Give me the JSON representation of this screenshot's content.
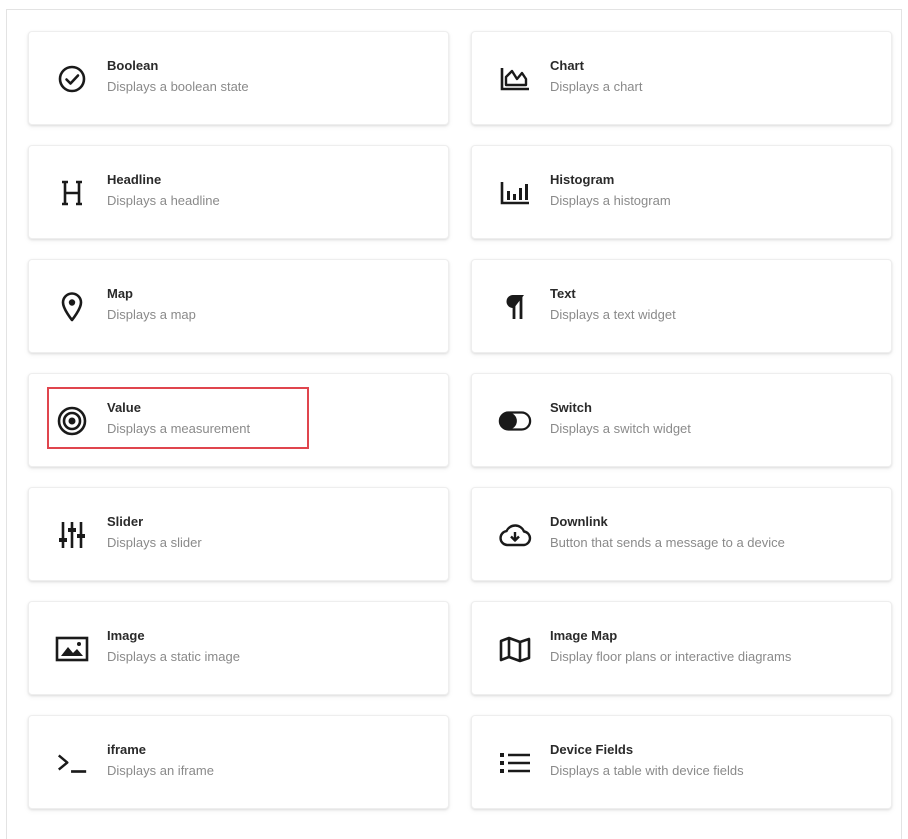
{
  "widgets": [
    {
      "title": "Boolean",
      "description": "Displays a boolean state",
      "icon": "check-circle-icon"
    },
    {
      "title": "Chart",
      "description": "Displays a chart",
      "icon": "area-chart-icon"
    },
    {
      "title": "Headline",
      "description": "Displays a headline",
      "icon": "headline-h-icon"
    },
    {
      "title": "Histogram",
      "description": "Displays a histogram",
      "icon": "bar-chart-icon"
    },
    {
      "title": "Map",
      "description": "Displays a map",
      "icon": "map-pin-icon"
    },
    {
      "title": "Text",
      "description": "Displays a text widget",
      "icon": "pilcrow-icon"
    },
    {
      "title": "Value",
      "description": "Displays a measurement",
      "icon": "target-icon"
    },
    {
      "title": "Switch",
      "description": "Displays a switch widget",
      "icon": "toggle-icon"
    },
    {
      "title": "Slider",
      "description": "Displays a slider",
      "icon": "sliders-icon"
    },
    {
      "title": "Downlink",
      "description": "Button that sends a message to a device",
      "icon": "cloud-download-icon"
    },
    {
      "title": "Image",
      "description": "Displays a static image",
      "icon": "image-icon"
    },
    {
      "title": "Image Map",
      "description": "Display floor plans or interactive diagrams",
      "icon": "folded-map-icon"
    },
    {
      "title": "iframe",
      "description": "Displays an iframe",
      "icon": "terminal-icon"
    },
    {
      "title": "Device Fields",
      "description": "Displays a table with device fields",
      "icon": "list-icon"
    }
  ],
  "highlighted_widget": "Value",
  "colors": {
    "highlight_border": "#e0454d",
    "icon": "#1a1a1a",
    "title": "#2a2a2a",
    "description": "#8a8a8a"
  }
}
